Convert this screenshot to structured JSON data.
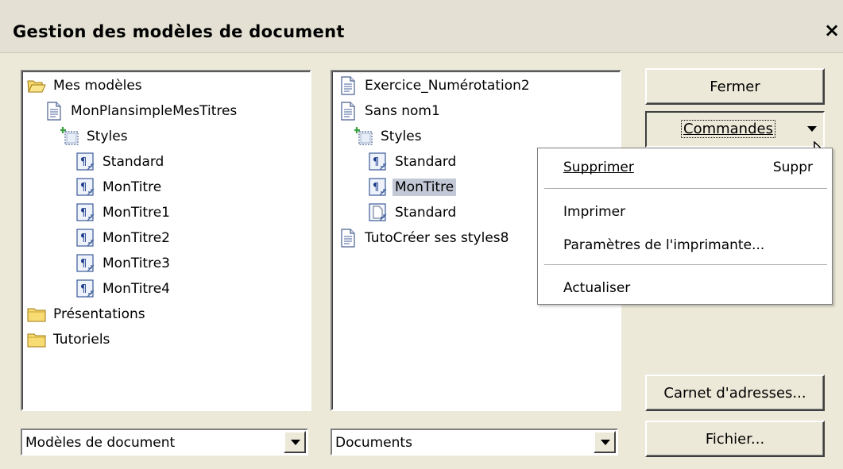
{
  "window": {
    "title": "Gestion des modèles de document",
    "close_glyph": "×"
  },
  "left_tree": {
    "items": [
      {
        "label": "Mes modèles",
        "icon": "folder-open-icon"
      },
      {
        "label": "MonPlansimpleMesTitres",
        "icon": "document-icon"
      },
      {
        "label": "Styles",
        "icon": "styles-icon"
      },
      {
        "label": "Standard",
        "icon": "paragraph-style-icon"
      },
      {
        "label": "MonTitre",
        "icon": "paragraph-style-icon"
      },
      {
        "label": "MonTitre1",
        "icon": "paragraph-style-icon"
      },
      {
        "label": "MonTitre2",
        "icon": "paragraph-style-icon"
      },
      {
        "label": "MonTitre3",
        "icon": "paragraph-style-icon"
      },
      {
        "label": "MonTitre4",
        "icon": "paragraph-style-icon"
      },
      {
        "label": "Présentations",
        "icon": "folder-icon"
      },
      {
        "label": "Tutoriels",
        "icon": "folder-icon"
      }
    ]
  },
  "right_tree": {
    "items": [
      {
        "label": "Exercice_Numérotation2",
        "icon": "document-icon"
      },
      {
        "label": "Sans nom1",
        "icon": "document-icon"
      },
      {
        "label": "Styles",
        "icon": "styles-icon"
      },
      {
        "label": "Standard",
        "icon": "paragraph-style-icon"
      },
      {
        "label": "MonTitre",
        "icon": "paragraph-style-icon",
        "selected": true
      },
      {
        "label": "Standard",
        "icon": "page-style-icon"
      },
      {
        "label": "TutoCréer ses styles8",
        "icon": "document-icon"
      }
    ]
  },
  "buttons": {
    "close": "Fermer",
    "commands": "Commandes",
    "address_book": "Carnet d'adresses...",
    "file": "Fichier..."
  },
  "commands_menu": {
    "delete": {
      "label": "Supprimer",
      "shortcut": "Suppr"
    },
    "print": "Imprimer",
    "printer_settings": "Paramètres de l'imprimante...",
    "update": "Actualiser"
  },
  "combos": {
    "left": "Modèles de document",
    "right": "Documents"
  }
}
